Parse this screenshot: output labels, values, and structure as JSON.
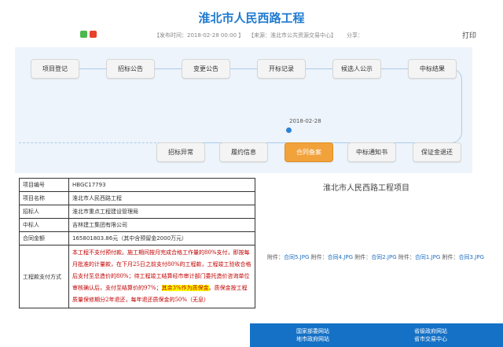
{
  "title": "淮北市人民西路工程",
  "meta": {
    "published": "【发布时间：2018-02-28 00:00 】",
    "source": "【来源：淮北市公共资源交易中心】",
    "share": "分享：",
    "print": "打印"
  },
  "flow": {
    "top_steps": [
      "项目登记",
      "招标公告",
      "变更公告",
      "开标记录",
      "候选人公示",
      "中标结果"
    ],
    "bottom_steps": [
      "招标异常",
      "履约信息",
      "合同备案",
      "中标通知书",
      "保证金退还"
    ],
    "active_step": "合同备案",
    "current_date": "2018-02-28"
  },
  "info_table": [
    {
      "key": "项目编号",
      "value": "HBGC17793"
    },
    {
      "key": "项目名称",
      "value": "淮北市人民西路工程"
    },
    {
      "key": "招标人",
      "value": "淮北市重点工程建设管理局"
    },
    {
      "key": "中标人",
      "value": "吉林建工集团有限公司"
    },
    {
      "key": "合同金额",
      "value": "165801803.86元（其中含预留金2000万元）"
    }
  ],
  "payment": {
    "key": "工程款支付方式",
    "text_before": "本工程不支付预付款。施工期间按月完成合格工作量的80%支付，即按每月批准的计量款，在下月25日之前支付80%的工程款，工程竣工验收合格后支付至总造价的80%；待工程竣工结算经市审计部门委托造价咨询单位审核确认后，支付至结算价的97%；",
    "text_highlight": "其余3%作为质保金",
    "text_after": "。质保金按工程质量保修期分2年退还，每年退还质保金的50%（无息）"
  },
  "project_name": "淮北市人民西路工程项目",
  "attachments": {
    "items": [
      {
        "prefix": "附件：",
        "name": "合同5.JPG"
      },
      {
        "prefix": "附件：",
        "name": "合同4.JPG"
      },
      {
        "prefix": "附件：",
        "name": "合同2.JPG"
      },
      {
        "prefix": "附件：",
        "name": "合同1.JPG"
      },
      {
        "prefix": "附件：",
        "name": "合同3.JPG"
      }
    ]
  },
  "footer": {
    "left_line1": "国家部委网站",
    "left_line2": "地市政府网站",
    "right_line1": "省级政府网站",
    "right_line2": "省市交易中心"
  },
  "colors": {
    "title": "#1e7ad0",
    "active_step": "#f2a23b",
    "footer": "#1571c6",
    "payment_text": "#c00000"
  }
}
